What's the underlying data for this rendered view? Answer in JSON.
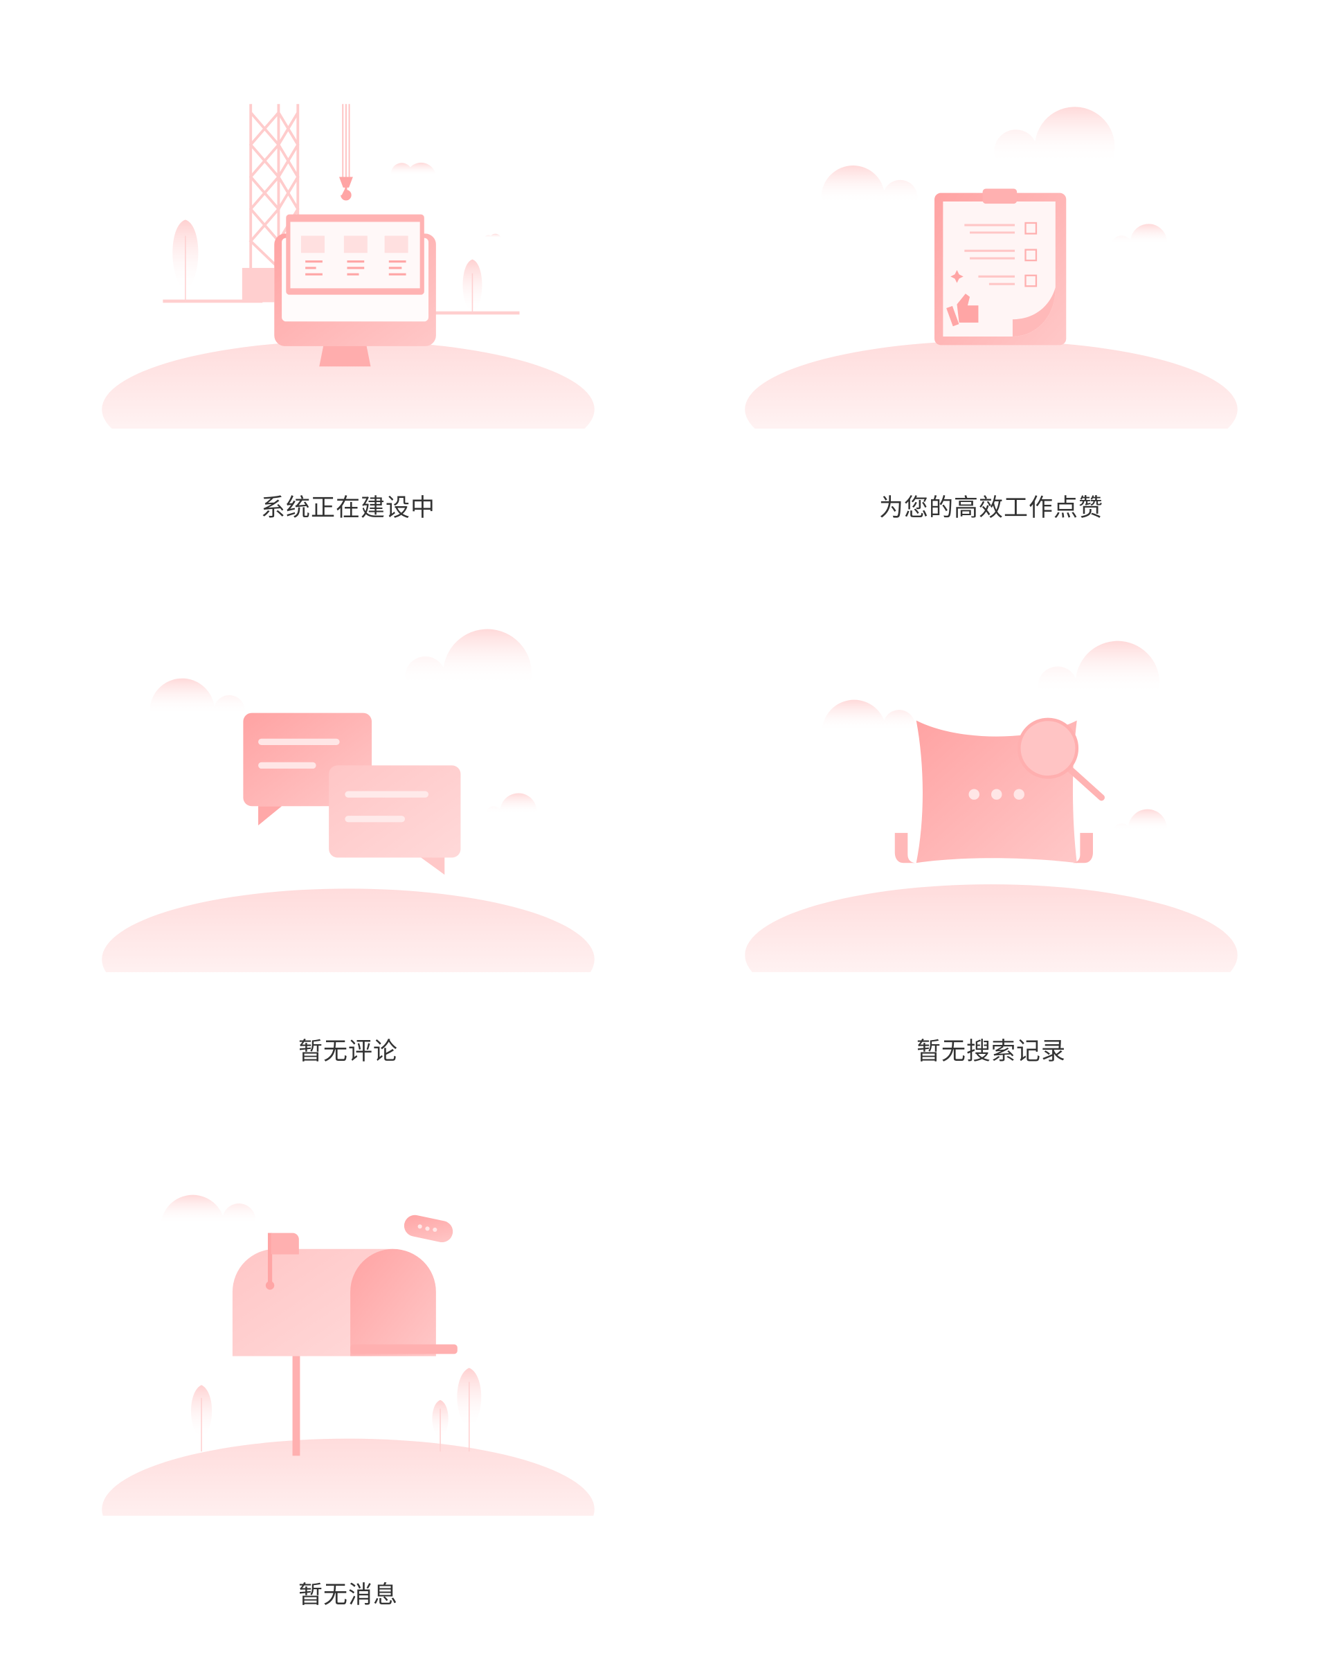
{
  "states": [
    {
      "id": "under-construction",
      "caption": "系统正在建设中"
    },
    {
      "id": "like-work",
      "caption": "为您的高效工作点赞"
    },
    {
      "id": "no-comments",
      "caption": "暂无评论"
    },
    {
      "id": "no-search-history",
      "caption": "暂无搜索记录"
    },
    {
      "id": "no-messages",
      "caption": "暂无消息"
    }
  ],
  "colors": {
    "primary": "#FFA5A5",
    "light": "#FFE3E3",
    "text": "#333333"
  }
}
